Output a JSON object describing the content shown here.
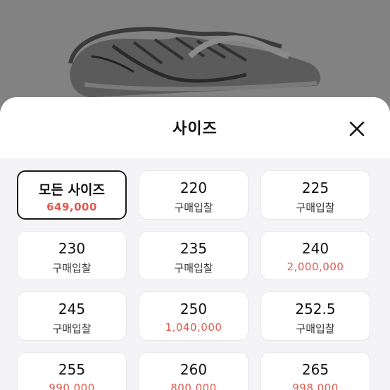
{
  "sheet": {
    "title": "사이즈"
  },
  "colors": {
    "price": "#e05a4f",
    "selected_border": "#1a1a1a"
  },
  "icons": {
    "close": "close-icon"
  },
  "sizes": [
    {
      "size": "모든 사이즈",
      "sub": "649,000",
      "sub_type": "price",
      "selected": true
    },
    {
      "size": "220",
      "sub": "구매입찰",
      "sub_type": "bid",
      "selected": false
    },
    {
      "size": "225",
      "sub": "구매입찰",
      "sub_type": "bid",
      "selected": false
    },
    {
      "size": "230",
      "sub": "구매입찰",
      "sub_type": "bid",
      "selected": false
    },
    {
      "size": "235",
      "sub": "구매입찰",
      "sub_type": "bid",
      "selected": false
    },
    {
      "size": "240",
      "sub": "2,000,000",
      "sub_type": "price",
      "selected": false
    },
    {
      "size": "245",
      "sub": "구매입찰",
      "sub_type": "bid",
      "selected": false
    },
    {
      "size": "250",
      "sub": "1,040,000",
      "sub_type": "price",
      "selected": false
    },
    {
      "size": "252.5",
      "sub": "구매입찰",
      "sub_type": "bid",
      "selected": false
    },
    {
      "size": "255",
      "sub": "990,000",
      "sub_type": "price",
      "selected": false
    },
    {
      "size": "260",
      "sub": "800,000",
      "sub_type": "price",
      "selected": false
    },
    {
      "size": "265",
      "sub": "998,000",
      "sub_type": "price",
      "selected": false
    }
  ]
}
